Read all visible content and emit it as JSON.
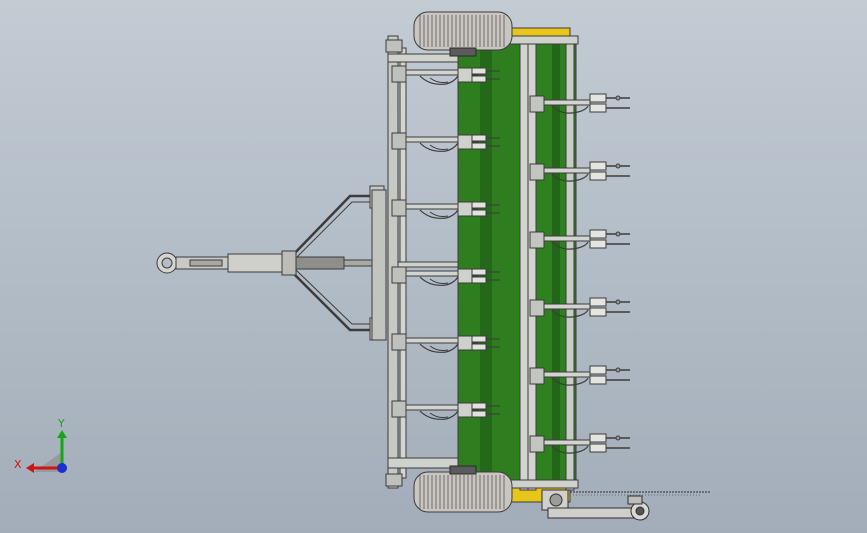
{
  "viewport": {
    "view": "top",
    "background_top": "#c3cbd3",
    "background_bottom": "#a2adb9"
  },
  "machine": {
    "frame_color": "#b9bbb6",
    "frame_edge": "#3c3c3c",
    "hopper_color": "#2e7d1f",
    "hopper_dark": "#1f5a14",
    "accent_yellow": "#e8c51a",
    "tire_color": "#c9c6c2",
    "front_tine_rows": 6,
    "rear_tine_rows": 6
  },
  "triad": {
    "x_label": "X",
    "y_label": "Y",
    "x_color": "#d01414",
    "y_color": "#17a617",
    "z_color": "#1a2fd0"
  }
}
